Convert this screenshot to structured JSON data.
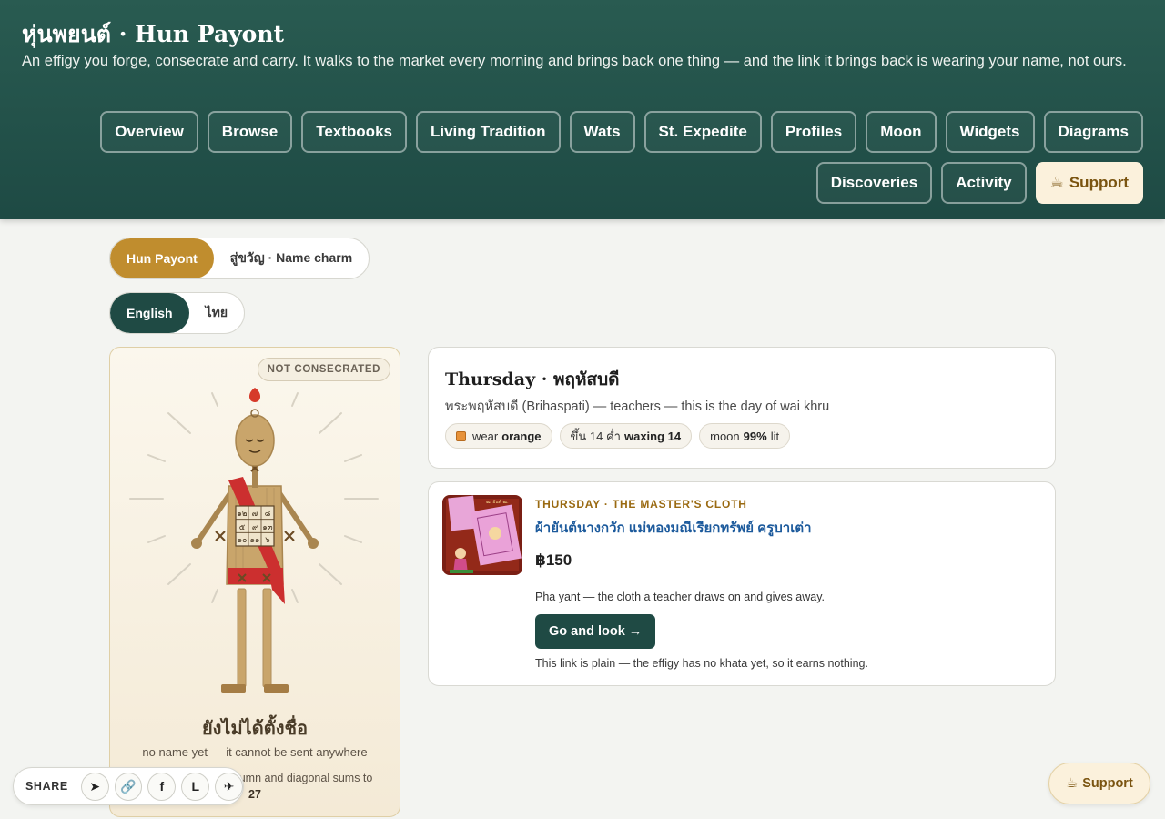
{
  "header": {
    "title": "หุ่นพยนต์ · Hun Payont",
    "subtitle": "An effigy you forge, consecrate and carry. It walks to the market every morning and brings back one thing — and the link it brings back is wearing your name, not ours."
  },
  "nav": {
    "items": [
      "Overview",
      "Browse",
      "Textbooks",
      "Living Tradition",
      "Wats",
      "St. Expedite",
      "Profiles",
      "Moon",
      "Widgets",
      "Diagrams",
      "Discoveries",
      "Activity"
    ],
    "support_icon": "☕",
    "support_label": "Support"
  },
  "mode_toggle": {
    "options": [
      "Hun Payont",
      "สู่ขวัญ · Name charm"
    ],
    "selected": "Hun Payont"
  },
  "language_toggle": {
    "options": [
      "English",
      "ไทย"
    ],
    "selected": "English"
  },
  "effigy": {
    "badge": "NOT CONSECRATED",
    "yantra": [
      "๒",
      "๗",
      "๖",
      "๙",
      "๕",
      "๑",
      "๔",
      "๓",
      "๘"
    ],
    "yantra_rows": [
      "๑๒ ๗ ๘",
      "๕ ๙ ๑๓",
      "๑๐ ๑๑ ๖"
    ],
    "name": "ยังไม่ได้ตั้งชื่อ",
    "name_sub": "no name yet — it cannot be sent anywhere",
    "magic_text_visible": "olumn and diagonal sums to",
    "magic_sum": "27"
  },
  "day": {
    "title": "Thursday · พฤหัสบดี",
    "description": "พระพฤหัสบดี (Brihaspati) — teachers — this is the day of wai khru",
    "chips": {
      "wear_prefix": "wear",
      "wear_color_name": "orange",
      "wear_color": "#e7923a",
      "lunar_prefix": "ขึ้น 14 ค่ำ",
      "lunar_value": "waxing 14",
      "moon_prefix": "moon",
      "moon_value": "99%",
      "moon_suffix": "lit"
    }
  },
  "offer": {
    "kicker": "THURSDAY · THE MASTER'S CLOTH",
    "link_text": "ผ้ายันต์นางกวัก แม่ทองมณีเรียกทรัพย์ ครูบาเต่า",
    "price": "฿150",
    "description": "Pha yant — the cloth a teacher draws on and gives away.",
    "cta": "Go and look →",
    "note": "This link is plain — the effigy has no khata yet, so it earns nothing."
  },
  "share": {
    "label": "SHARE",
    "icons": [
      {
        "name": "send-icon",
        "glyph": "➤"
      },
      {
        "name": "link-icon",
        "glyph": "🔗"
      },
      {
        "name": "facebook-icon",
        "glyph": "f"
      },
      {
        "name": "line-icon",
        "glyph": "L"
      },
      {
        "name": "telegram-icon",
        "glyph": "✈"
      }
    ]
  },
  "floating_support": {
    "icon": "☕",
    "label": "Support"
  },
  "colors": {
    "header": "#1f4a44",
    "gold": "#c08d2e",
    "link": "#1c5a9c",
    "cream": "#fbf1dc"
  }
}
